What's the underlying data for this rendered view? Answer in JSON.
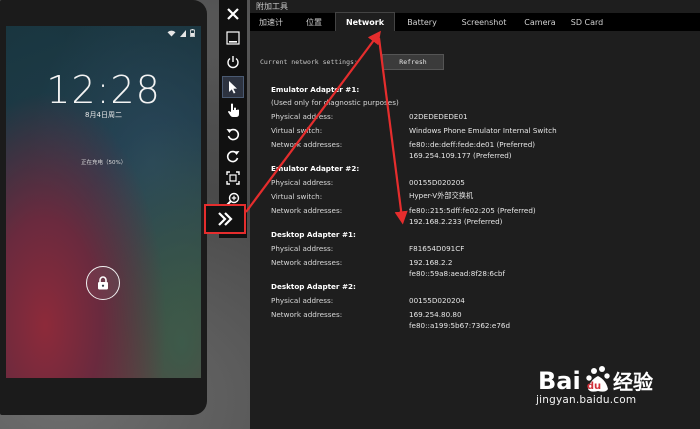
{
  "phone": {
    "clock": "12:28",
    "date": "8月4日周二",
    "charging": "正在充电（50%）"
  },
  "toolbar": {
    "buttons": [
      "close-icon",
      "minimize-icon",
      "power-icon",
      "pointer-icon",
      "touch-icon",
      "rotate-left-icon",
      "rotate-right-icon",
      "fit-screen-icon",
      "zoom-icon",
      "expand-icon"
    ]
  },
  "tools": {
    "title": "附加工具",
    "tabs": [
      "加速计",
      "位置",
      "Network",
      "Battery",
      "Screenshot",
      "Camera",
      "SD Card"
    ],
    "active_tab": "Network"
  },
  "network": {
    "current_label": "Current network settings:",
    "refresh_label": "Refresh",
    "adapters": [
      {
        "title": "Emulator Adapter #1:",
        "note": "(Used only for diagnostic purposes)",
        "rows": [
          {
            "label": "Physical address:",
            "values": [
              "02DEDEDEDE01"
            ]
          },
          {
            "label": "Virtual switch:",
            "values": [
              "Windows Phone Emulator Internal Switch"
            ]
          },
          {
            "label": "Network addresses:",
            "values": [
              "fe80::de:deff:fede:de01 (Preferred)",
              "169.254.109.177 (Preferred)"
            ]
          }
        ]
      },
      {
        "title": "Emulator Adapter #2:",
        "note": "",
        "rows": [
          {
            "label": "Physical address:",
            "values": [
              "00155D020205"
            ]
          },
          {
            "label": "Virtual switch:",
            "values": [
              "Hyper-V外部交换机"
            ]
          },
          {
            "label": "Network addresses:",
            "values": [
              "fe80::215:5dff:fe02:205 (Preferred)",
              "192.168.2.233 (Preferred)"
            ]
          }
        ]
      },
      {
        "title": "Desktop Adapter #1:",
        "note": "",
        "rows": [
          {
            "label": "Physical address:",
            "values": [
              "F81654D091CF"
            ]
          },
          {
            "label": "Network addresses:",
            "values": [
              "192.168.2.2",
              "fe80::59a8:aead:8f28:6cbf"
            ]
          }
        ]
      },
      {
        "title": "Desktop Adapter #2:",
        "note": "",
        "rows": [
          {
            "label": "Physical address:",
            "values": [
              "00155D020204"
            ]
          },
          {
            "label": "Network addresses:",
            "values": [
              "169.254.80.80",
              "fe80::a199:5b67:7362:e76d"
            ]
          }
        ]
      }
    ]
  },
  "watermark": {
    "text": "jingyan.baidu.com",
    "logo_text": "Baidu经验"
  },
  "colors": {
    "highlight": "#e52d2d",
    "panel_bg": "#1e1e1e",
    "tab_bg": "#000000"
  }
}
